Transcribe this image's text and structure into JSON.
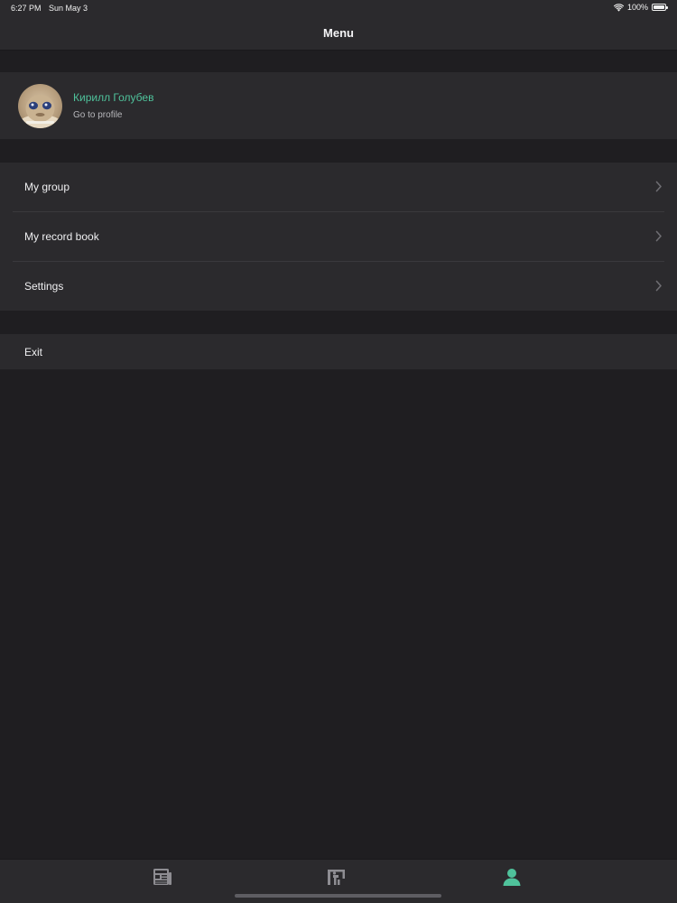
{
  "status_bar": {
    "time": "6:27 PM",
    "date": "Sun May 3",
    "battery": "100%",
    "battery_level": 1.0
  },
  "nav": {
    "title": "Menu"
  },
  "profile": {
    "name": "Кирилл Голубев",
    "subtitle": "Go to profile"
  },
  "menu": {
    "items": [
      {
        "label": "My group",
        "icon": "chevron-right-icon"
      },
      {
        "label": "My record book",
        "icon": "chevron-right-icon"
      },
      {
        "label": "Settings",
        "icon": "chevron-right-icon"
      }
    ],
    "exit_label": "Exit"
  },
  "tab_bar": {
    "tabs": [
      {
        "icon": "news-icon",
        "active": false
      },
      {
        "icon": "schedule-icon",
        "active": false
      },
      {
        "icon": "profile-icon",
        "active": true
      }
    ]
  },
  "colors": {
    "accent": "#4fc29b",
    "background": "#1f1e21",
    "surface": "#2b2a2d",
    "inactive_icon": "#8e8d92"
  }
}
